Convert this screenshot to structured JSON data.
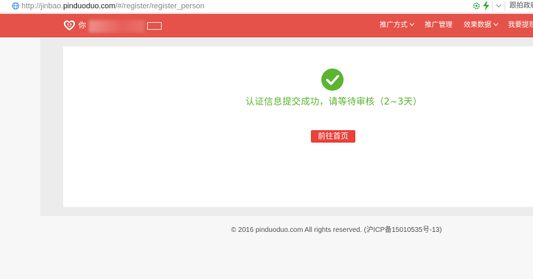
{
  "browser": {
    "url_prefix": "http://jinbao.",
    "url_domain": "pinduoduo.com",
    "url_path": "/#/register/register_person",
    "right_text": "跟拍政府"
  },
  "header": {
    "greeting": "你",
    "nav": [
      {
        "label": "推广方式",
        "has_dropdown": true
      },
      {
        "label": "推广管理",
        "has_dropdown": false
      },
      {
        "label": "效果数据",
        "has_dropdown": true
      },
      {
        "label": "我要提现",
        "has_dropdown": false
      }
    ],
    "colors": {
      "header_bg": "#e5524a",
      "accent_green": "#5bb531",
      "button_red": "#e9423c"
    }
  },
  "main": {
    "icon": "check-circle-icon",
    "message": "认证信息提交成功，请等待审核（2~3天）",
    "button_label": "前往首页"
  },
  "footer": {
    "text": "© 2016 pinduoduo.com All rights reserved. (沪ICP备15010535号-13)"
  }
}
